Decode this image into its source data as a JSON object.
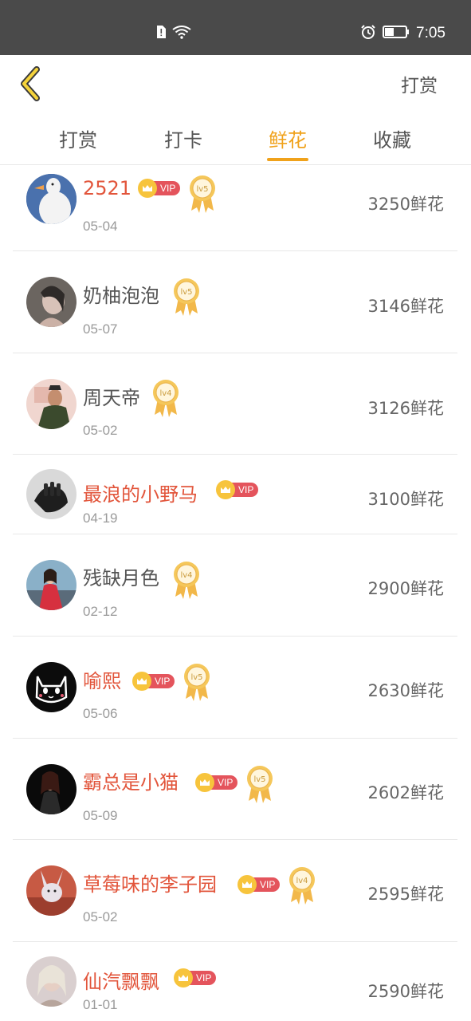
{
  "status_bar": {
    "time": "7:05"
  },
  "nav": {
    "action_label": "打赏"
  },
  "tabs": [
    {
      "label": "打赏",
      "active": false
    },
    {
      "label": "打卡",
      "active": false
    },
    {
      "label": "鲜花",
      "active": true
    },
    {
      "label": "收藏",
      "active": false
    }
  ],
  "list": [
    {
      "name": "2521",
      "date": "05-04",
      "amount": "3250鲜花",
      "vip": true,
      "vip_label": "VIP",
      "level": "lv5"
    },
    {
      "name": "奶柚泡泡",
      "date": "05-07",
      "amount": "3146鲜花",
      "vip": false,
      "level": "lv5"
    },
    {
      "name": "周天帝",
      "date": "05-02",
      "amount": "3126鲜花",
      "vip": false,
      "level": "lv4"
    },
    {
      "name": "最浪的小野马",
      "date": "04-19",
      "amount": "3100鲜花",
      "vip": true,
      "vip_label": "VIP",
      "level": ""
    },
    {
      "name": "残缺月色",
      "date": "02-12",
      "amount": "2900鲜花",
      "vip": false,
      "level": "lv4"
    },
    {
      "name": "喻熙",
      "date": "05-06",
      "amount": "2630鲜花",
      "vip": true,
      "vip_label": "VIP",
      "level": "lv5"
    },
    {
      "name": "霸总是小猫",
      "date": "05-09",
      "amount": "2602鲜花",
      "vip": true,
      "vip_label": "VIP",
      "level": "lv5"
    },
    {
      "name": "草莓味的李子园",
      "date": "05-02",
      "amount": "2595鲜花",
      "vip": true,
      "vip_label": "VIP",
      "level": "lv4"
    },
    {
      "name": "仙汽飘飘",
      "date": "01-01",
      "amount": "2590鲜花",
      "vip": true,
      "vip_label": "VIP",
      "level": ""
    }
  ],
  "colors": {
    "accent": "#f0a21b",
    "vip_name": "#e2553b",
    "vip_badge": "#e4545c",
    "status_bar": "#4a4a4a"
  }
}
